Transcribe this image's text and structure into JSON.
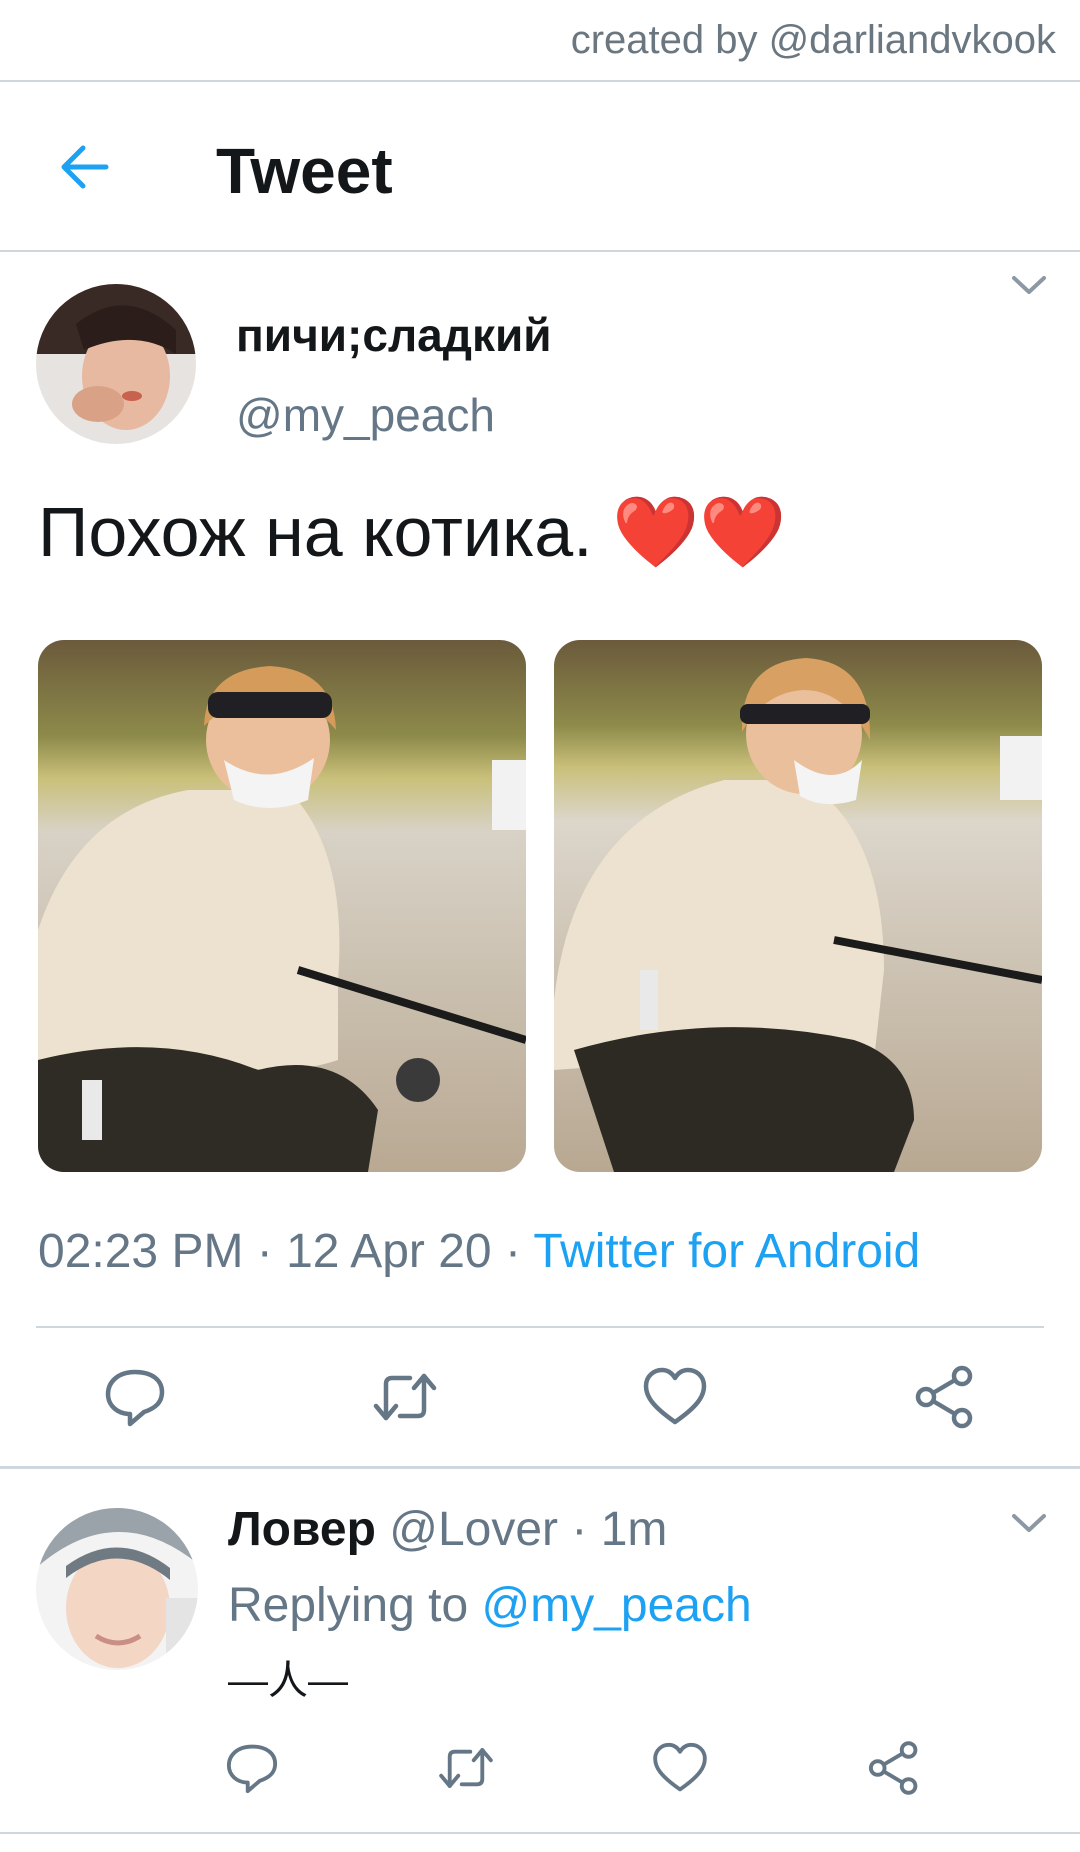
{
  "credit": {
    "text": "created by @darliandvkook"
  },
  "header": {
    "back_icon": "arrow-left-icon",
    "title": "Tweet"
  },
  "tweet": {
    "author_name": "пичи;сладкий",
    "author_handle": "@my_peach",
    "text": "Похож на котика.",
    "emoji": "❤️❤️",
    "timestamp": "02:23 PM · 12 Apr 20 · ",
    "source": "Twitter for Android",
    "actions": [
      "reply-icon",
      "retweet-icon",
      "like-icon",
      "share-icon"
    ]
  },
  "reply": {
    "author_name": "Ловер",
    "author_handle": "@Lover",
    "time": " · 1m",
    "replying_prefix": "Replying to ",
    "replying_to": "@my_peach",
    "text": "—人—",
    "actions": [
      "reply-icon",
      "retweet-icon",
      "like-icon",
      "share-icon"
    ]
  },
  "colors": {
    "accent": "#1da1f2",
    "secondary_text": "#657786",
    "heart": "#e0242c",
    "divider": "#cfd6dc"
  }
}
